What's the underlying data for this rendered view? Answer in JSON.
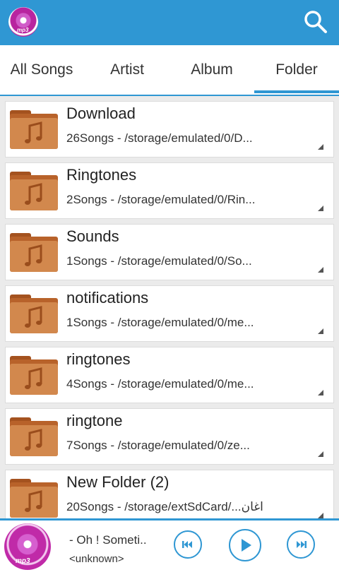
{
  "app": {
    "logo_text": "mp3",
    "accent_color": "#2f97d3"
  },
  "tabs": [
    {
      "label": "All Songs"
    },
    {
      "label": "Artist"
    },
    {
      "label": "Album"
    },
    {
      "label": "Folder"
    }
  ],
  "selected_tab": "Folder",
  "folders": [
    {
      "name": "Download",
      "details": "26Songs  -  /storage/emulated/0/D..."
    },
    {
      "name": "Ringtones",
      "details": "2Songs  -  /storage/emulated/0/Rin..."
    },
    {
      "name": "Sounds",
      "details": "1Songs  -  /storage/emulated/0/So..."
    },
    {
      "name": "notifications",
      "details": "1Songs  -  /storage/emulated/0/me..."
    },
    {
      "name": "ringtones",
      "details": "4Songs  -  /storage/emulated/0/me..."
    },
    {
      "name": "ringtone",
      "details": "7Songs  -  /storage/emulated/0/ze..."
    },
    {
      "name": "New Folder (2)",
      "details": "20Songs  -  /storage/extSdCard/...اغان"
    }
  ],
  "player": {
    "art_text": "mp3",
    "title": "- Oh ! Someti..",
    "artist": "<unknown>"
  },
  "icons": {
    "search": "search-icon",
    "folder": "music-folder-icon",
    "previous": "skip-previous-icon",
    "play": "play-icon",
    "next": "skip-next-icon"
  }
}
